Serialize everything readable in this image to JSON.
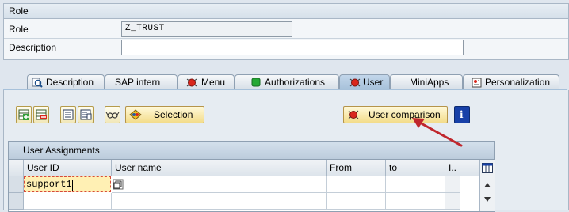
{
  "role_section": {
    "title": "Role",
    "role_label": "Role",
    "role_value": "Z_TRUST",
    "description_label": "Description",
    "description_value": ""
  },
  "tabs": [
    {
      "label": "Description",
      "icon": "magnifier-page-icon"
    },
    {
      "label": "SAP intern",
      "icon": ""
    },
    {
      "label": "Menu",
      "icon": "red-status-icon"
    },
    {
      "label": "Authorizations",
      "icon": "green-status-icon"
    },
    {
      "label": "User",
      "icon": "red-status-icon",
      "active": true
    },
    {
      "label": "MiniApps",
      "icon": ""
    },
    {
      "label": "Personalization",
      "icon": "personalization-icon"
    }
  ],
  "toolbar": {
    "selection_label": "Selection",
    "user_comparison_label": "User comparison",
    "info_label": "i"
  },
  "user_assignments": {
    "title": "User Assignments",
    "columns": [
      "User ID",
      "User name",
      "From",
      "to",
      "I.."
    ],
    "rows": [
      {
        "user_id": "support1",
        "user_name": "",
        "from": "",
        "to": ""
      },
      {
        "user_id": "",
        "user_name": "",
        "from": "",
        "to": ""
      }
    ]
  },
  "colors": {
    "status_red": "#d9261c",
    "status_green": "#25a834",
    "active_tab": "#a7c1da",
    "button_yellow": "#f3dc8a",
    "arrow": "#c0272d"
  }
}
